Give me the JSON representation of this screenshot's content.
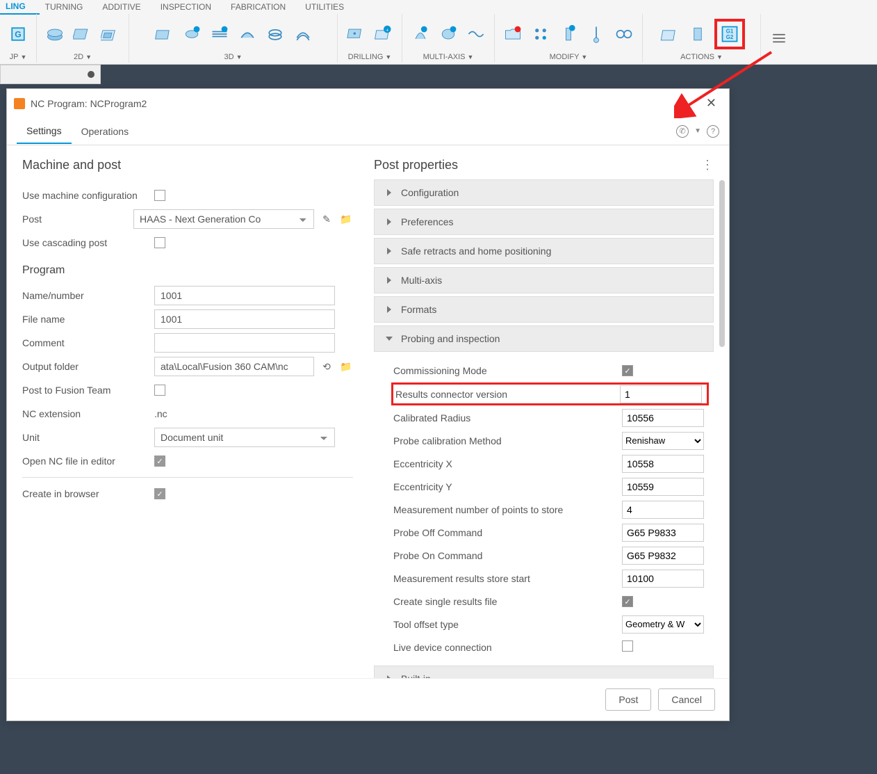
{
  "ribbon": {
    "tabs": [
      "LING",
      "TURNING",
      "ADDITIVE",
      "INSPECTION",
      "FABRICATION",
      "UTILITIES"
    ],
    "groups": {
      "setup": "JP",
      "g2d": "2D",
      "g3d": "3D",
      "drilling": "DRILLING",
      "multiaxis": "MULTI-AXIS",
      "modify": "MODIFY",
      "actions": "ACTIONS"
    }
  },
  "dialog": {
    "title": "NC Program: NCProgram2",
    "tabs": {
      "settings": "Settings",
      "operations": "Operations"
    }
  },
  "left": {
    "heading1": "Machine and post",
    "use_machine": "Use machine configuration",
    "post_label": "Post",
    "post_value": "HAAS - Next Generation Co",
    "cascading": "Use cascading post",
    "heading2": "Program",
    "name_label": "Name/number",
    "name_value": "1001",
    "file_label": "File name",
    "file_value": "1001",
    "comment_label": "Comment",
    "comment_value": "",
    "output_label": "Output folder",
    "output_value": "ata\\Local\\Fusion 360 CAM\\nc",
    "fusionteam": "Post to Fusion Team",
    "ncext_label": "NC extension",
    "ncext_value": ".nc",
    "unit_label": "Unit",
    "unit_value": "Document unit",
    "openeditor": "Open NC file in editor",
    "createbrowser": "Create in browser"
  },
  "right": {
    "heading": "Post properties",
    "sections": {
      "config": "Configuration",
      "prefs": "Preferences",
      "safe": "Safe retracts and home positioning",
      "multi": "Multi-axis",
      "formats": "Formats",
      "probing": "Probing and inspection",
      "builtin": "Built-in"
    },
    "probing": {
      "commissioning": "Commissioning Mode",
      "results_label": "Results connector version",
      "results_value": "1",
      "calrad_label": "Calibrated Radius",
      "calrad_value": "10556",
      "calmethod_label": "Probe calibration Method",
      "calmethod_value": "Renishaw",
      "ecx_label": "Eccentricity X",
      "ecx_value": "10558",
      "ecy_label": "Eccentricity Y",
      "ecy_value": "10559",
      "mnp_label": "Measurement number of points to store",
      "mnp_value": "4",
      "poff_label": "Probe Off Command",
      "poff_value": "G65 P9833",
      "pon_label": "Probe On Command",
      "pon_value": "G65 P9832",
      "mrs_label": "Measurement results store start",
      "mrs_value": "10100",
      "csrf": "Create single results file",
      "tot_label": "Tool offset type",
      "tot_value": "Geometry & W",
      "ldc": "Live device connection"
    }
  },
  "footer": {
    "post": "Post",
    "cancel": "Cancel"
  }
}
